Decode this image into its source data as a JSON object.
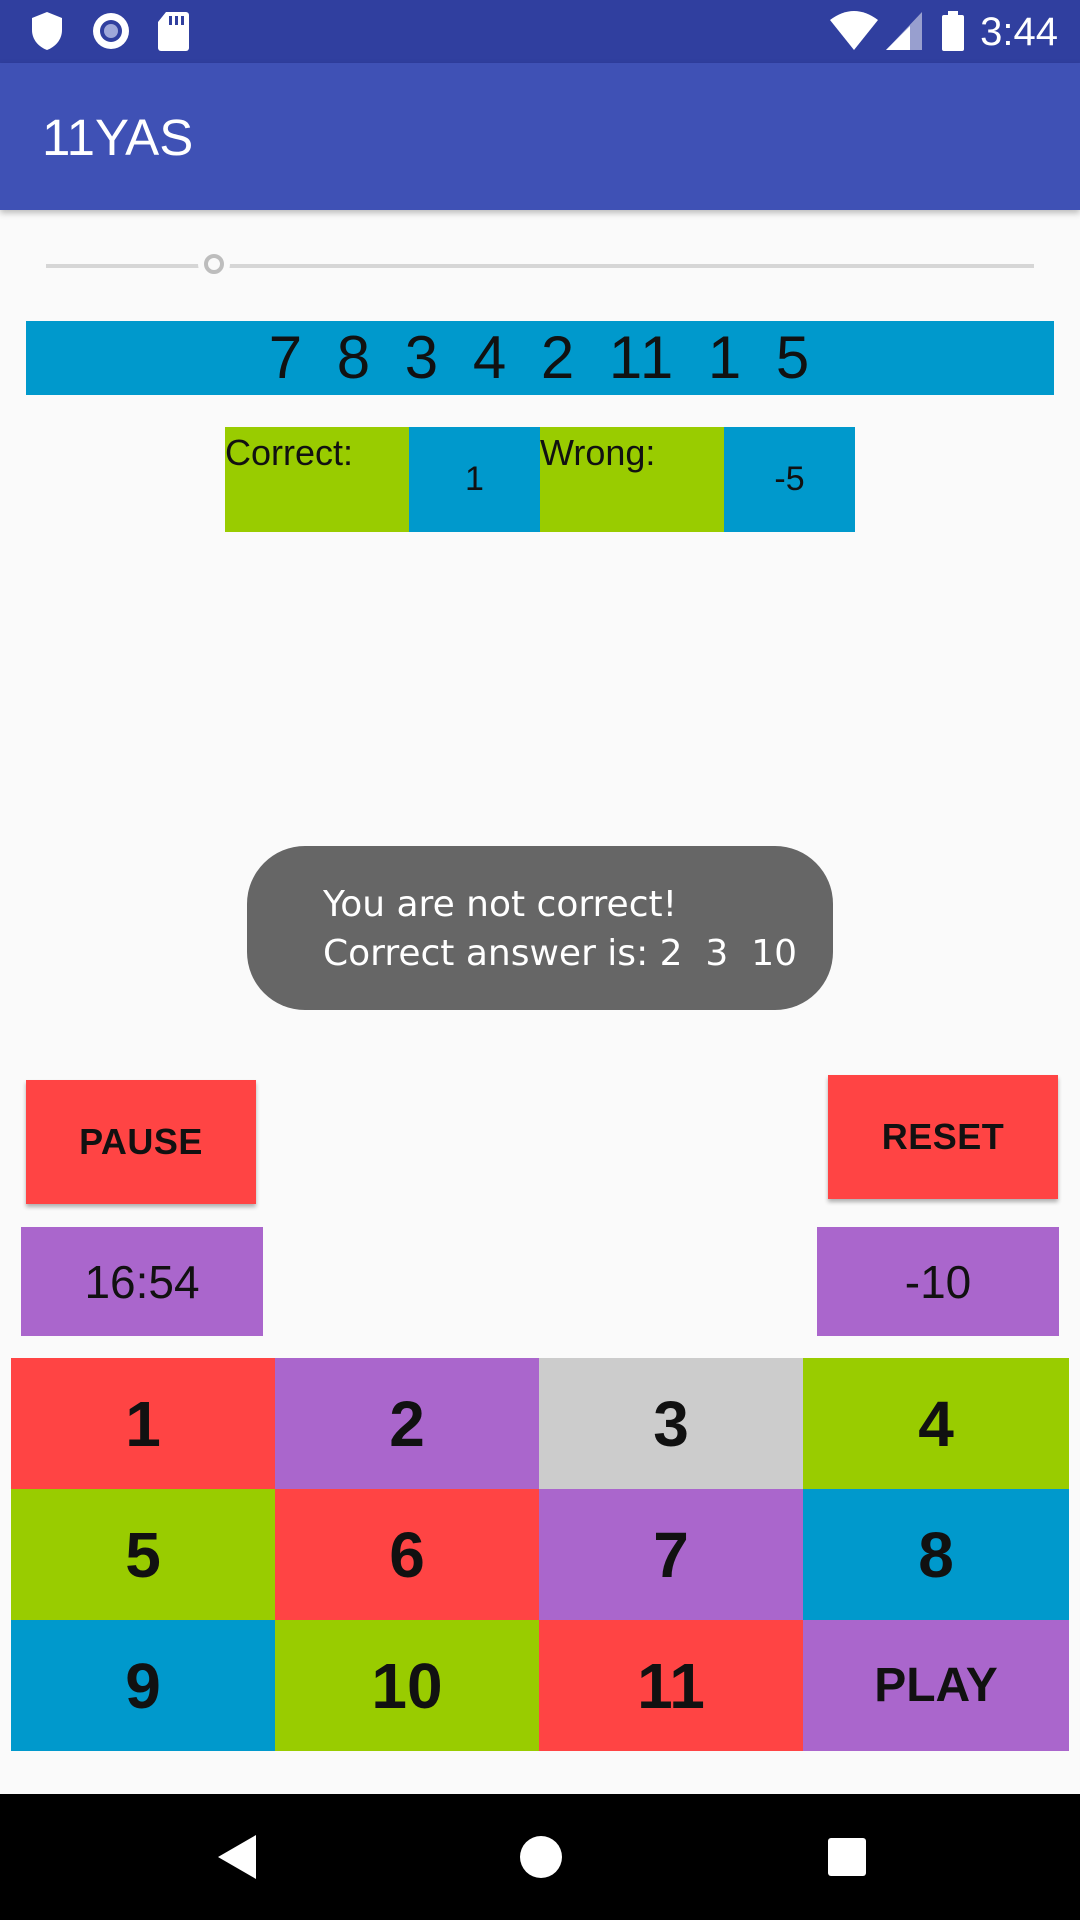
{
  "status_bar": {
    "time": "3:44",
    "icons_left": [
      "shield-icon",
      "radio-icon",
      "sd-card-icon"
    ],
    "icons_right": [
      "wifi-icon",
      "signal-icon",
      "battery-icon"
    ]
  },
  "app_bar": {
    "title": "11YAS"
  },
  "slider": {
    "value_fraction": 0.17
  },
  "sequence": {
    "text": "7  8  3  4  2  11  1  5"
  },
  "score": {
    "correct_label": "Correct:",
    "correct_value": "1",
    "wrong_label": "Wrong:",
    "wrong_value": "-5"
  },
  "toast": {
    "line1": "You are not correct!",
    "line2": "Correct answer is: 2  3  10"
  },
  "controls": {
    "pause_label": "PAUSE",
    "reset_label": "RESET",
    "timer": "16:54",
    "points": "-10"
  },
  "keypad": {
    "keys": [
      {
        "label": "1",
        "color": "#ff4444"
      },
      {
        "label": "2",
        "color": "#aa66cc"
      },
      {
        "label": "3",
        "color": "#cccccc"
      },
      {
        "label": "4",
        "color": "#99cc00"
      },
      {
        "label": "5",
        "color": "#99cc00"
      },
      {
        "label": "6",
        "color": "#ff4444"
      },
      {
        "label": "7",
        "color": "#aa66cc"
      },
      {
        "label": "8",
        "color": "#0099cc"
      },
      {
        "label": "9",
        "color": "#0099cc"
      },
      {
        "label": "10",
        "color": "#99cc00"
      },
      {
        "label": "11",
        "color": "#ff4444"
      },
      {
        "label": "PLAY",
        "color": "#aa66cc"
      }
    ]
  },
  "colors": {
    "status_bar": "#303f9f",
    "app_bar": "#3f51b5",
    "blue": "#0099cc",
    "green": "#99cc00",
    "red": "#ff4444",
    "purple": "#aa66cc",
    "grey": "#cccccc"
  },
  "nav_bar": {
    "icons": [
      "back-icon",
      "home-icon",
      "recents-icon"
    ]
  }
}
